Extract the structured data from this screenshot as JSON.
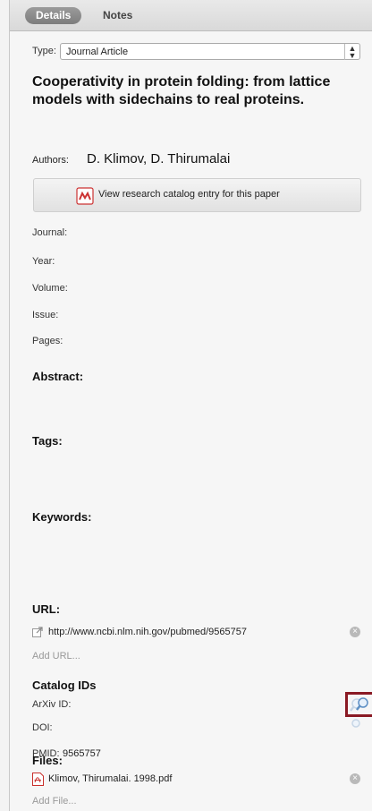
{
  "tabs": {
    "details": "Details",
    "notes": "Notes"
  },
  "type": {
    "label": "Type:",
    "value": "Journal Article"
  },
  "title": "Cooperativity in protein folding: from lattice models with sidechains to real proteins.",
  "authors": {
    "label": "Authors:",
    "value": "D. Klimov, D. Thirumalai"
  },
  "catalog_button": "View research catalog entry for this paper",
  "fields": {
    "journal": "Journal:",
    "year": "Year:",
    "volume": "Volume:",
    "issue": "Issue:",
    "pages": "Pages:"
  },
  "sections": {
    "abstract": "Abstract:",
    "tags": "Tags:",
    "keywords": "Keywords:",
    "url": "URL:",
    "catalog_ids": "Catalog IDs",
    "files": "Files:"
  },
  "url": {
    "value": "http://www.ncbi.nlm.nih.gov/pubmed/9565757",
    "add": "Add URL..."
  },
  "catalog_ids": {
    "arxiv_label": "ArXiv ID:",
    "doi_label": "DOI:",
    "pmid_label": "PMID:",
    "pmid_value": "9565757"
  },
  "files": {
    "name": "Klimov, Thirumalai. 1998.pdf",
    "add": "Add File..."
  },
  "colors": {
    "highlight": "#8a1a24",
    "tab_active": "#8a8a8a"
  }
}
